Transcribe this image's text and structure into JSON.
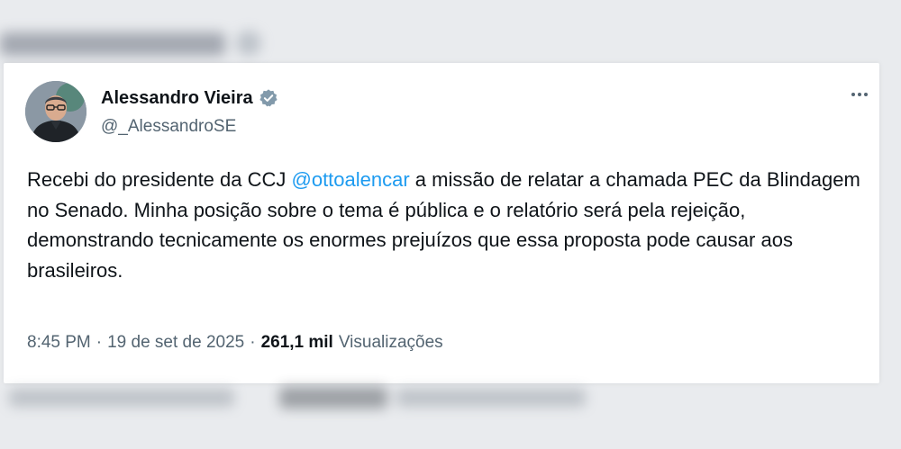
{
  "author": {
    "display_name": "Alessandro Vieira",
    "handle": "@_AlessandroSE",
    "verified": true,
    "verified_color": "#829aab"
  },
  "tweet": {
    "text_before": "Recebi do presidente da CCJ ",
    "mention": "@ottoalencar",
    "text_after": " a missão de relatar a chamada PEC da Blindagem no Senado. Minha posição sobre o tema é pública e o relatório será pela rejeição, demonstrando tecnicamente os enormes prejuízos que essa proposta pode causar aos brasileiros."
  },
  "meta": {
    "time": "8:45 PM",
    "separator": "·",
    "date": "19 de set de 2025",
    "views_count": "261,1 mil",
    "views_label": "Visualizações"
  },
  "icons": {
    "verified": "verified-badge-icon",
    "more": "more-options-icon"
  },
  "colors": {
    "mention": "#1d9bf0",
    "secondary_text": "#536471",
    "primary_text": "#0f1419"
  }
}
